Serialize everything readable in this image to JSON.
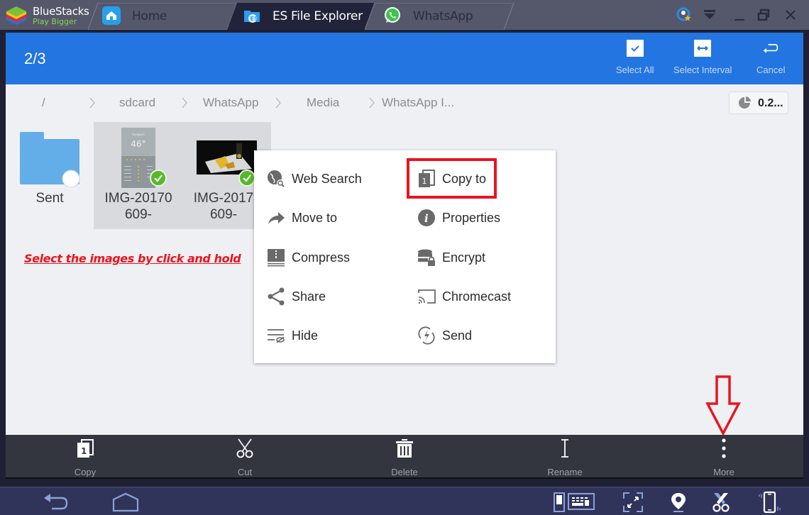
{
  "window": {
    "brand": {
      "title": "BlueStacks",
      "subtitle": "Play Bigger"
    },
    "tabs": [
      {
        "label": "Home",
        "icon": "home-icon",
        "active": false
      },
      {
        "label": "ES File Explorer",
        "icon": "es-file-explorer-icon",
        "active": true
      },
      {
        "label": "WhatsApp",
        "icon": "whatsapp-icon",
        "active": false
      }
    ],
    "controls": [
      "account-star-icon",
      "dropdown-icon",
      "minimize-icon",
      "restore-icon",
      "close-icon"
    ]
  },
  "header": {
    "selection_count": "2/3",
    "actions": [
      {
        "label": "Select All",
        "icon": "select-all-icon"
      },
      {
        "label": "Select Interval",
        "icon": "select-interval-icon"
      },
      {
        "label": "Cancel",
        "icon": "cancel-icon"
      }
    ]
  },
  "breadcrumb": [
    "/",
    "sdcard",
    "WhatsApp",
    "Media",
    "WhatsApp I..."
  ],
  "storage_indicator": "0.2...",
  "files": [
    {
      "name": "Sent",
      "type": "folder",
      "selected": false
    },
    {
      "name_line1": "IMG-20170",
      "name_line2": "609-",
      "type": "image",
      "selected": true
    },
    {
      "name_line1": "IMG-2017",
      "name_line2": "609-",
      "type": "image",
      "selected": true
    }
  ],
  "annotation": "Select the images by click and hold",
  "context_menu": {
    "left": [
      {
        "label": "Web Search",
        "icon": "web-search-icon"
      },
      {
        "label": "Move to",
        "icon": "move-to-icon"
      },
      {
        "label": "Compress",
        "icon": "compress-icon"
      },
      {
        "label": "Share",
        "icon": "share-icon"
      },
      {
        "label": "Hide",
        "icon": "hide-icon"
      }
    ],
    "right": [
      {
        "label": "Copy to",
        "icon": "copy-to-icon",
        "highlighted": true
      },
      {
        "label": "Properties",
        "icon": "properties-icon"
      },
      {
        "label": "Encrypt",
        "icon": "encrypt-icon"
      },
      {
        "label": "Chromecast",
        "icon": "chromecast-icon"
      },
      {
        "label": "Send",
        "icon": "send-icon"
      }
    ]
  },
  "toolbar": [
    {
      "label": "Copy",
      "icon": "copy-icon"
    },
    {
      "label": "Cut",
      "icon": "cut-icon"
    },
    {
      "label": "Delete",
      "icon": "delete-icon"
    },
    {
      "label": "Rename",
      "icon": "rename-icon"
    },
    {
      "label": "More",
      "icon": "more-icon"
    }
  ],
  "navbar": [
    "back-icon",
    "home-icon",
    "keyboard-toggle-icon",
    "fullscreen-icon",
    "location-icon",
    "scissors-icon",
    "shake-icon"
  ],
  "colors": {
    "accent": "#2375e1",
    "highlight_red": "#e8151f",
    "check_green": "#59b82a",
    "folder_blue": "#63aee8"
  }
}
